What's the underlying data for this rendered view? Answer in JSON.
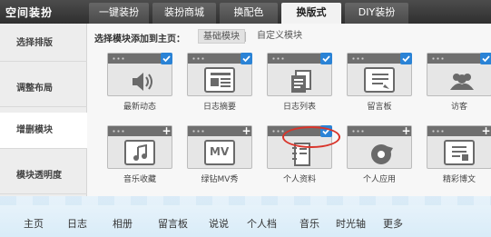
{
  "app_title": "空间装扮",
  "tabs": [
    {
      "label": "一键装扮"
    },
    {
      "label": "装扮商城"
    },
    {
      "label": "换配色"
    },
    {
      "label": "换版式"
    },
    {
      "label": "DIY装扮"
    }
  ],
  "active_tab": "换版式",
  "sidebar": {
    "items": [
      {
        "label": "选择排版"
      },
      {
        "label": "调整布局"
      },
      {
        "label": "增删模块"
      },
      {
        "label": "模块透明度"
      }
    ],
    "active": "增删模块"
  },
  "main": {
    "add_label": "选择模块添加到主页：",
    "sub_tabs": [
      {
        "label": "基础模块"
      },
      {
        "label": "自定义模块"
      }
    ],
    "modules_row1": [
      {
        "label": "最新动态",
        "icon": "speaker-icon",
        "added": true
      },
      {
        "label": "日志摘要",
        "icon": "article-icon",
        "added": true
      },
      {
        "label": "日志列表",
        "icon": "document-list-icon",
        "added": true
      },
      {
        "label": "留言板",
        "icon": "message-board-icon",
        "added": true
      },
      {
        "label": "访客",
        "icon": "visitors-icon",
        "added": true
      }
    ],
    "modules_row2": [
      {
        "label": "音乐收藏",
        "icon": "music-note-icon",
        "added": false
      },
      {
        "label": "绿钻MV秀",
        "icon": "mv-icon",
        "added": false
      },
      {
        "label": "个人资料",
        "icon": "notebook-icon",
        "added": true
      },
      {
        "label": "个人应用",
        "icon": "app-refresh-icon",
        "added": false
      },
      {
        "label": "精彩博文",
        "icon": "blog-post-icon",
        "added": false
      }
    ],
    "mv_text": "MV"
  },
  "bottom_nav": [
    {
      "label": "主页"
    },
    {
      "label": "日志"
    },
    {
      "label": "相册"
    },
    {
      "label": "留言板"
    },
    {
      "label": "说说"
    },
    {
      "label": "个人档"
    },
    {
      "label": "音乐"
    },
    {
      "label": "时光轴"
    },
    {
      "label": "更多"
    }
  ],
  "colors": {
    "check_badge": "#2a83d6",
    "highlight": "#d9352b",
    "topbar": "#3a3a3a"
  }
}
